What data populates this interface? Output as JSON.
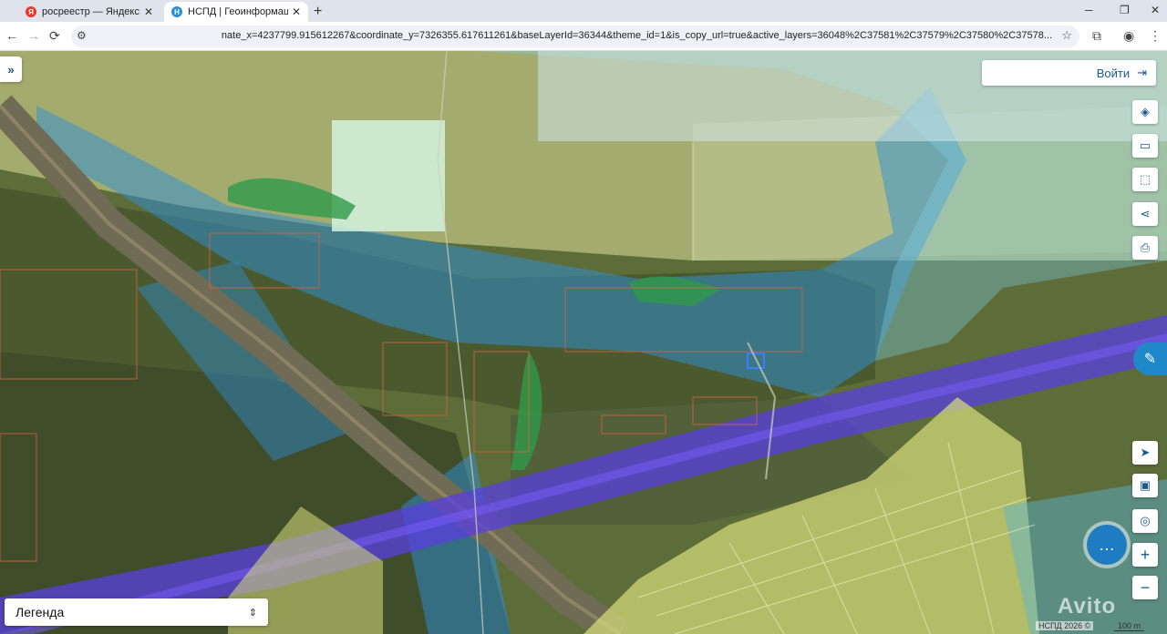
{
  "browser": {
    "tabs": [
      {
        "title": "росреестр — Яндекс: нашлось",
        "close": "✕",
        "favicon_letter": "Я",
        "favicon_color": "#e8392b"
      },
      {
        "title": "НСПД | Геоинформационный",
        "close": "✕",
        "favicon_letter": "Н",
        "favicon_color": "#2a8fd0"
      }
    ],
    "new_tab": "+",
    "window_controls": {
      "minimize": "─",
      "maximize": "❐",
      "close": "✕"
    },
    "nav": {
      "back": "←",
      "forward": "→",
      "reload": "⟳",
      "site_info": "⚙"
    },
    "url": "nate_x=4237799.915612267&coordinate_y=7326355.617611261&baseLayerId=36344&theme_id=1&is_copy_url=true&active_layers=36048%2C37581%2C37579%2C37580%2C37578...",
    "bookmark": "☆",
    "extensions": "⧉",
    "profile": "◉",
    "menu": "⋮"
  },
  "map": {
    "sidebar_toggle": "»",
    "login_label": "Войти",
    "login_icon": "⇥",
    "tools": [
      {
        "name": "layers-icon",
        "glyph": "◈"
      },
      {
        "name": "ruler-icon",
        "glyph": "▭"
      },
      {
        "name": "select-area-icon",
        "glyph": "⬚"
      },
      {
        "name": "share-icon",
        "glyph": "⋖"
      },
      {
        "name": "print-icon",
        "glyph": "⎙"
      },
      {
        "name": "navigate-icon",
        "glyph": "➤"
      },
      {
        "name": "minimap-icon",
        "glyph": "▣"
      },
      {
        "name": "locate-icon",
        "glyph": "◎"
      },
      {
        "name": "zoom-in-icon",
        "glyph": "+"
      },
      {
        "name": "zoom-out-icon",
        "glyph": "−"
      }
    ],
    "assistant_icon": "✎",
    "chat_icon": "…",
    "legend_label": "Легенда",
    "legend_toggle": "⇕",
    "attribution": "НСПД 2026 ©",
    "scale": "100 m",
    "watermark": "Avito",
    "colors": {
      "terrain": "#5d6d3a",
      "field": "#a6ad72",
      "forest": "#3f4d2a",
      "water_zone": "#2d8fd8",
      "protection_zone": "#7fd0e8",
      "pipeline": "#5a3fe0",
      "parcels_yellow": "#d8e07a",
      "parcel_outline": "#e06040"
    }
  }
}
